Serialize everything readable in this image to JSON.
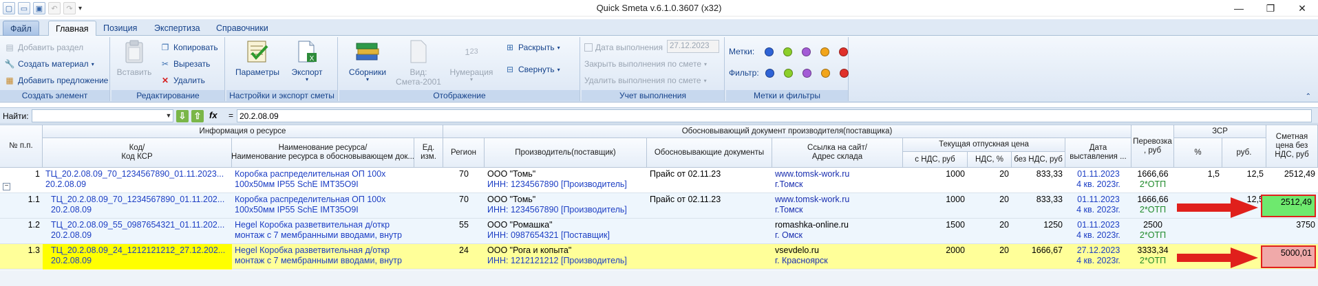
{
  "window": {
    "title": "Quick Smeta v.6.1.0.3607 (x32)",
    "minimize": "—",
    "restore": "❐",
    "close": "✕"
  },
  "ribbon_tabs": [
    {
      "label": "Файл"
    },
    {
      "label": "Главная"
    },
    {
      "label": "Позиция"
    },
    {
      "label": "Экспертиза"
    },
    {
      "label": "Справочники"
    }
  ],
  "groups": {
    "create": {
      "label": "Создать элемент",
      "add_section": "Добавить раздел",
      "create_material": "Создать материал",
      "add_offer": "Добавить предложение"
    },
    "edit": {
      "label": "Редактирование",
      "paste": "Вставить",
      "copy": "Копировать",
      "cut": "Вырезать",
      "delete": "Удалить"
    },
    "settings": {
      "label": "Настройки и экспорт сметы",
      "params": "Параметры",
      "export": "Экспорт"
    },
    "display": {
      "label": "Отображение",
      "collections": "Сборники",
      "view": "Вид:",
      "view_value": "Смета-2001",
      "numbering": "Нумерация",
      "expand": "Раскрыть",
      "collapse": "Свернуть"
    },
    "tracking": {
      "label": "Учет выполнения",
      "date_label": "Дата выполнения",
      "date_value": "27.12.2023",
      "close_by_estimate": "Закрыть выполнения по смете",
      "delete_by_estimate": "Удалить выполнения по смете"
    },
    "marks": {
      "label": "Метки и фильтры",
      "marks_label": "Метки:",
      "filter_label": "Фильтр:",
      "colors": [
        "#2f63d6",
        "#8ccf2a",
        "#a35bd6",
        "#f2a51a",
        "#e0312b"
      ]
    }
  },
  "findbar": {
    "label": "Найти:",
    "search_value": "",
    "fx": "fx",
    "equals": "=",
    "formula": "20.2.08.09"
  },
  "table": {
    "headers": {
      "num": "№ п.п.",
      "group_resource": "Информация о ресурсе",
      "code": "Код/\nКод КСР",
      "name": "Наименование ресурса/\nНаименование ресурса в обосновывающем док...",
      "unit": "Ед.\nизм.",
      "group_doc": "Обосновывающий документ производителя(поставщика)",
      "region": "Регион",
      "producer": "Производитель(поставщик)",
      "docs": "Обосновывающие  документы",
      "link": "Ссылка на сайт/\nАдрес склада",
      "group_price": "Текущая отпускная цена",
      "price_vat": "с НДС, руб",
      "vat": "НДС, %",
      "price_novat": "без НДС, руб",
      "date": "Дата\nвыставления ...",
      "transport": "Перевозка\n, руб",
      "group_zsr": "ЗСР",
      "zsr_pct": "%",
      "zsr_rub": "руб.",
      "est_price": "Сметная\nцена без\nНДС, руб"
    },
    "rows": [
      {
        "num": "1",
        "code": "ТЦ_20.2.08.09_70_1234567890_01.11.2023...",
        "code2": "20.2.08.09",
        "name": "Коробка распределительная ОП 100х",
        "name2": "100х50мм IP55 SchE IMT35O9I",
        "region": "70",
        "producer": "ООО \"Томь\"",
        "producer2": "ИНН: 1234567890 [Производитель]",
        "docs": "Прайс от 02.11.23",
        "link": "www.tomsk-work.ru",
        "link2": "г.Томск",
        "price_vat": "1000",
        "vat": "20",
        "price_novat": "833,33",
        "date": "01.11.2023",
        "date2": "4 кв. 2023г.",
        "transport": "1666,66",
        "transport2": "2*ОТП",
        "zsr_pct": "1,5",
        "zsr_rub": "12,5",
        "est_price": "2512,49"
      },
      {
        "num": "1.1",
        "code": "ТЦ_20.2.08.09_70_1234567890_01.11.202...",
        "code2": "20.2.08.09",
        "name": "Коробка распределительная ОП 100х",
        "name2": "100х50мм IP55 SchE IMT35O9I",
        "region": "70",
        "producer": "ООО \"Томь\"",
        "producer2": "ИНН: 1234567890 [Производитель]",
        "docs": "Прайс от 02.11.23",
        "link": "www.tomsk-work.ru",
        "link2": "г.Томск",
        "price_vat": "1000",
        "vat": "20",
        "price_novat": "833,33",
        "date": "01.11.2023",
        "date2": "4 кв. 2023г.",
        "transport": "1666,66",
        "transport2": "2*ОТП",
        "zsr_pct": "",
        "zsr_rub": "12,5",
        "est_price": "2512,49"
      },
      {
        "num": "1.2",
        "code": "ТЦ_20.2.08.09_55_0987654321_01.11.202...",
        "code2": "20.2.08.09",
        "name": "Hegel Коробка разветвительная д/откр",
        "name2": "монтаж с 7 мембранными вводами, внутр",
        "region": "55",
        "producer": "ООО \"Ромашка\"",
        "producer2": "ИНН: 0987654321 [Поставщик]",
        "docs": "",
        "link": "romashka-online.ru",
        "link2": "г. Омск",
        "price_vat": "1500",
        "vat": "20",
        "price_novat": "1250",
        "date": "01.11.2023",
        "date2": "4 кв. 2023г.",
        "transport": "2500",
        "transport2": "2*ОТП",
        "zsr_pct": "",
        "zsr_rub": "",
        "est_price": "3750"
      },
      {
        "num": "1.3",
        "code": "ТЦ_20.2.08.09_24_1212121212_27.12.202...",
        "code2": "20.2.08.09",
        "name": "Hegel Коробка разветвительная д/откр",
        "name2": "монтаж с 7 мембранными вводами, внутр",
        "region": "24",
        "producer": "ООО \"Рога и копыта\"",
        "producer2": "ИНН: 1212121212 [Производитель]",
        "docs": "",
        "link": "vsevdelo.ru",
        "link2": "г. Красноярск",
        "price_vat": "2000",
        "vat": "20",
        "price_novat": "1666,67",
        "date": "27.12.2023",
        "date2": "4 кв. 2023г.",
        "transport": "3333,34",
        "transport2": "2*ОТП",
        "zsr_pct": "",
        "zsr_rub": "",
        "est_price": "5000,01"
      }
    ]
  },
  "colors": {
    "highlight_row": "#ffff99",
    "highlight_code": "#ffff00",
    "est_green": "#6ee96e",
    "est_red": "#f0a9a9",
    "annotation_red": "#e0201c"
  }
}
